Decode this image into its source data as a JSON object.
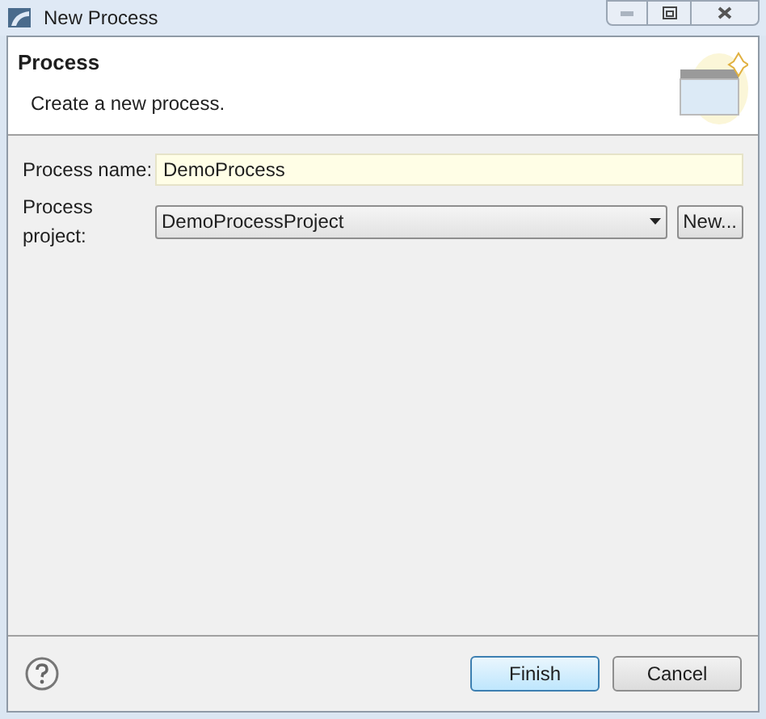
{
  "window": {
    "title": "New Process"
  },
  "header": {
    "title": "Process",
    "description": "Create a new process."
  },
  "form": {
    "name_label": "Process name:",
    "name_value": "DemoProcess",
    "project_label": "Process project:",
    "project_value": "DemoProcessProject",
    "new_button": "New..."
  },
  "buttons": [
    {
      "label": "Finish",
      "default": true
    },
    {
      "label": "Cancel",
      "default": false
    }
  ]
}
